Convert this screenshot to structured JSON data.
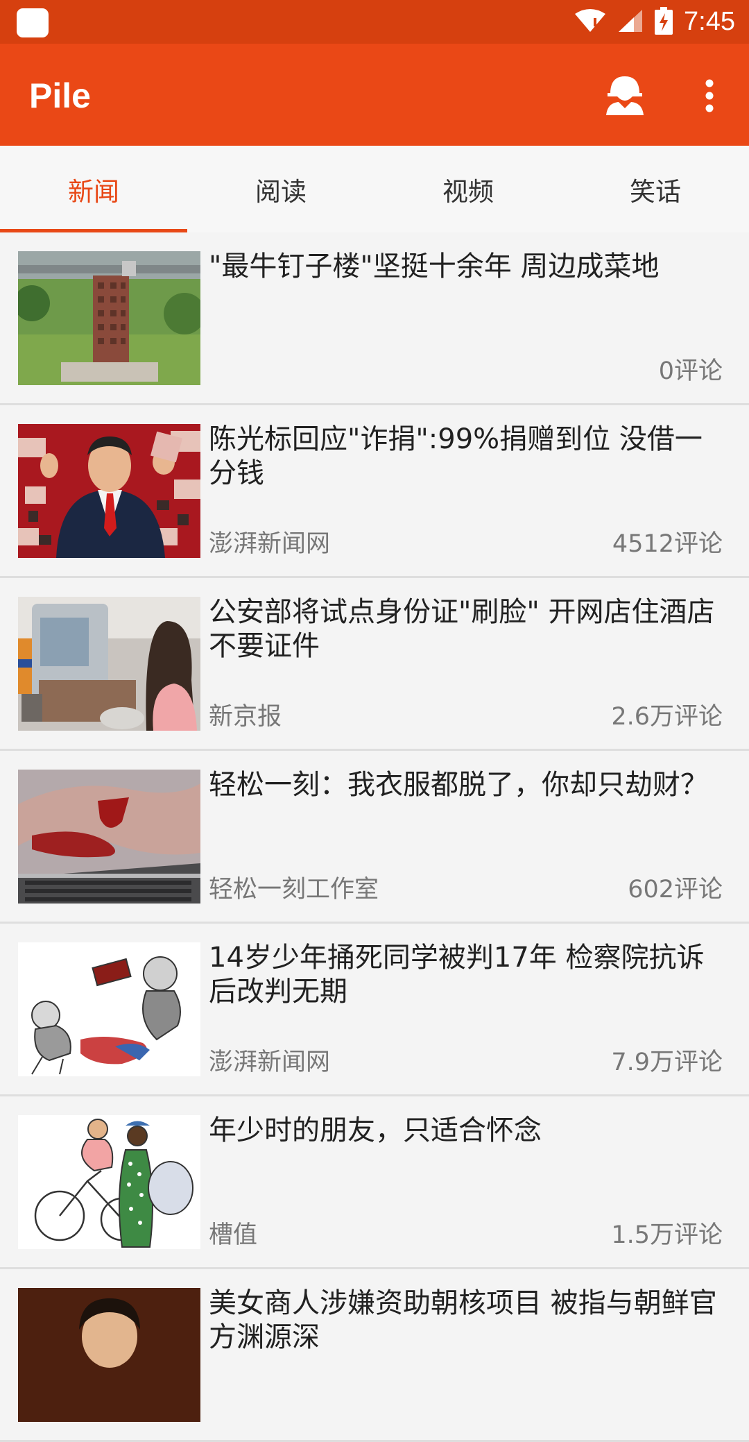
{
  "status_bar": {
    "time": "7:45",
    "icons": [
      "app-notification-icon",
      "wifi-icon",
      "signal-icon",
      "battery-charging-icon"
    ]
  },
  "app_bar": {
    "title": "Pile",
    "actions": [
      "account-icon",
      "more-vert-icon"
    ]
  },
  "tabs": [
    {
      "label": "新闻",
      "active": true
    },
    {
      "label": "阅读",
      "active": false
    },
    {
      "label": "视频",
      "active": false
    },
    {
      "label": "笑话",
      "active": false
    }
  ],
  "news": [
    {
      "title": "\"最牛钉子楼\"坚挺十余年 周边成菜地",
      "source": "",
      "comments": "0评论"
    },
    {
      "title": "陈光标回应\"诈捐\":99%捐赠到位 没借一分钱",
      "source": "澎湃新闻网",
      "comments": "4512评论"
    },
    {
      "title": "公安部将试点身份证\"刷脸\" 开网店住酒店不要证件",
      "source": "新京报",
      "comments": "2.6万评论"
    },
    {
      "title": "轻松一刻：我衣服都脱了，你却只劫财？",
      "source": "轻松一刻工作室",
      "comments": "602评论"
    },
    {
      "title": "14岁少年捅死同学被判17年 检察院抗诉后改判无期",
      "source": "澎湃新闻网",
      "comments": "7.9万评论"
    },
    {
      "title": "年少时的朋友，只适合怀念",
      "source": "槽值",
      "comments": "1.5万评论"
    },
    {
      "title": "美女商人涉嫌资助朝核项目 被指与朝鲜官方渊源深",
      "source": "",
      "comments": ""
    }
  ],
  "colors": {
    "status_bar": "#d6400f",
    "app_bar": "#ea4816",
    "accent": "#e84816"
  }
}
